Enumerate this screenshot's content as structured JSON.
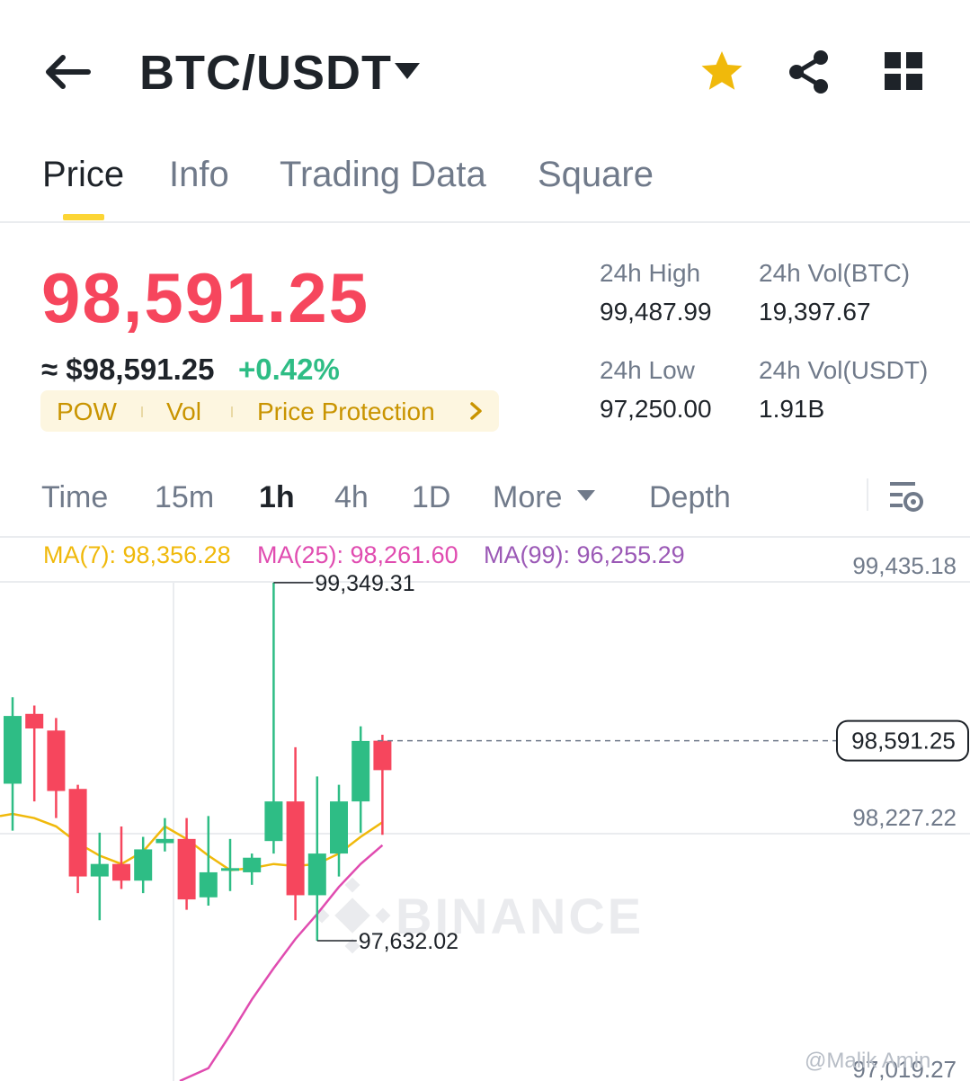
{
  "header": {
    "pair": "BTC/USDT",
    "icons": [
      "back-arrow-icon",
      "dropdown-caret-icon",
      "star-icon",
      "share-icon",
      "grid-icon"
    ],
    "favorite_color": "#f0b90b"
  },
  "tabs": [
    {
      "label": "Price",
      "active": true
    },
    {
      "label": "Info",
      "active": false
    },
    {
      "label": "Trading Data",
      "active": false
    },
    {
      "label": "Square",
      "active": false
    }
  ],
  "price": {
    "last": "98,591.25",
    "approx": "≈ $98,591.25",
    "change": "+0.42%",
    "up_color": "#2ebd85",
    "down_color": "#f6465d",
    "tags": [
      "POW",
      "Vol",
      "Price Protection"
    ]
  },
  "stats": {
    "high_label": "24h High",
    "high_value": "99,487.99",
    "low_label": "24h Low",
    "low_value": "97,250.00",
    "vol_btc_label": "24h Vol(BTC)",
    "vol_btc_value": "19,397.67",
    "vol_usdt_label": "24h Vol(USDT)",
    "vol_usdt_value": "1.91B"
  },
  "intervals": [
    {
      "label": "Time",
      "active": false
    },
    {
      "label": "15m",
      "active": false
    },
    {
      "label": "1h",
      "active": true
    },
    {
      "label": "4h",
      "active": false
    },
    {
      "label": "1D",
      "active": false
    },
    {
      "label": "More",
      "active": false
    },
    {
      "label": "Depth",
      "active": false
    }
  ],
  "ma": {
    "ma7": "MA(7): 98,356.28",
    "ma25": "MA(25): 98,261.60",
    "ma99": "MA(99): 96,255.29",
    "ma7_color": "#f0b90b",
    "ma25_color": "#e04cb0",
    "ma99_color": "#9b59b6"
  },
  "chart_data": {
    "type": "candlestick",
    "axis_labels": [
      "99,435.18",
      "98,227.22",
      "97,019.27"
    ],
    "current_price_label": "98,591.25",
    "high_marker": "99,349.31",
    "low_marker": "97,632.02",
    "watermark": "BINANCE",
    "candles": [
      {
        "o": 98385,
        "h": 98800,
        "l": 98160,
        "c": 98710
      },
      {
        "o": 98720,
        "h": 98760,
        "l": 98300,
        "c": 98650
      },
      {
        "o": 98640,
        "h": 98700,
        "l": 98220,
        "c": 98350
      },
      {
        "o": 98360,
        "h": 98380,
        "l": 97860,
        "c": 97940
      },
      {
        "o": 97940,
        "h": 98150,
        "l": 97730,
        "c": 98000
      },
      {
        "o": 98000,
        "h": 98180,
        "l": 97880,
        "c": 97920
      },
      {
        "o": 97920,
        "h": 98130,
        "l": 97860,
        "c": 98070
      },
      {
        "o": 98100,
        "h": 98220,
        "l": 98060,
        "c": 98120
      },
      {
        "o": 98120,
        "h": 98220,
        "l": 97780,
        "c": 97830
      },
      {
        "o": 97840,
        "h": 98230,
        "l": 97800,
        "c": 97960
      },
      {
        "o": 97980,
        "h": 98120,
        "l": 97870,
        "c": 97980
      },
      {
        "o": 97960,
        "h": 98050,
        "l": 97900,
        "c": 98030
      },
      {
        "o": 98110,
        "h": 99349.31,
        "l": 98050,
        "c": 98300
      },
      {
        "o": 98300,
        "h": 98560,
        "l": 97730,
        "c": 97850
      },
      {
        "o": 97850,
        "h": 98420,
        "l": 97632.02,
        "c": 98050
      },
      {
        "o": 98050,
        "h": 98380,
        "l": 97940,
        "c": 98300
      },
      {
        "o": 98300,
        "h": 98660,
        "l": 98150,
        "c": 98590
      },
      {
        "o": 98591.25,
        "h": 98620,
        "l": 98140,
        "c": 98450
      }
    ],
    "ma7_values": [
      98240,
      98220,
      98180,
      98100,
      98040,
      98000,
      98060,
      98180,
      98120,
      98040,
      97970,
      97980,
      98000,
      97990,
      98000,
      98050,
      98130,
      98200
    ],
    "ma25_values": [
      97020,
      97180,
      97350,
      97500,
      97640,
      97760,
      97890,
      98000,
      98090
    ]
  },
  "footer": {
    "user_watermark": "@Malik Amin"
  }
}
